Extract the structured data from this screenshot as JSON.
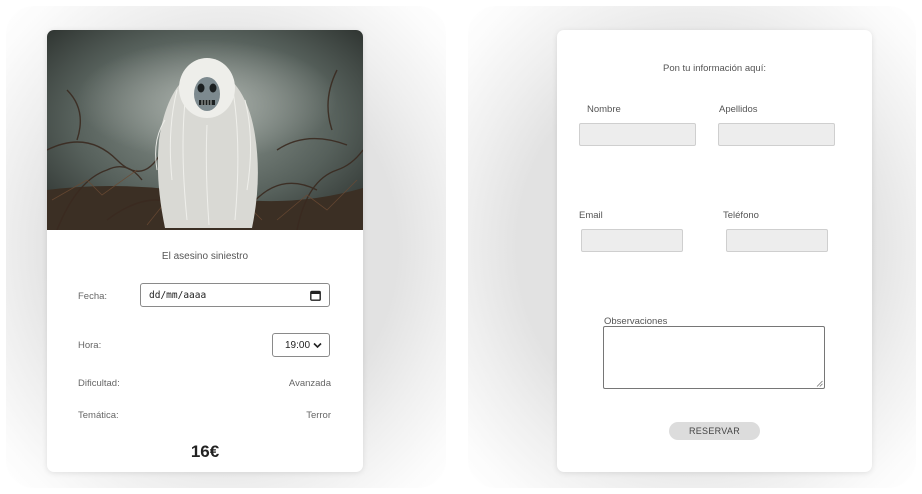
{
  "product": {
    "name": "El asesino siniestro",
    "fecha_label": "Fecha:",
    "fecha_placeholder": "dd/mm/aaaa",
    "hora_label": "Hora:",
    "hora_value": "19:00",
    "dificultad_label": "Dificultad:",
    "dificultad_value": "Avanzada",
    "tematica_label": "Temática:",
    "tematica_value": "Terror",
    "price": "16€",
    "icons": {
      "date": "calendar-icon",
      "select": "chevron-down-icon"
    }
  },
  "form": {
    "heading": "Pon tu información aquí:",
    "nombre_label": "Nombre",
    "apellidos_label": "Apellidos",
    "email_label": "Email",
    "telefono_label": "Teléfono",
    "observaciones_label": "Observaciones",
    "submit_label": "RESERVAR"
  },
  "colors": {
    "card_bg": "#ffffff",
    "input_bg": "#ededed",
    "button_bg": "#dcdcdc",
    "price_text": "#222222"
  }
}
